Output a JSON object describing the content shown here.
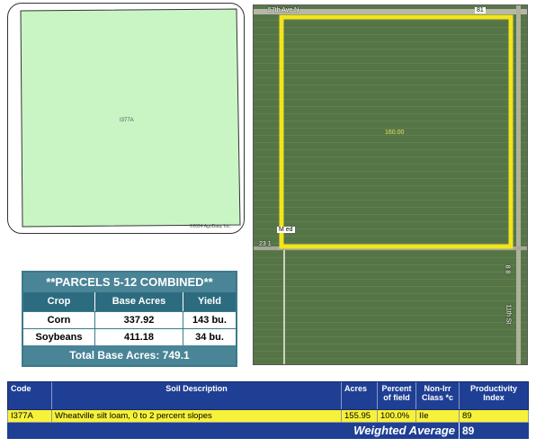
{
  "soil_map": {
    "map_label": "I377A",
    "credit": "©2024 AgriData, Inc."
  },
  "aerial": {
    "road_top": "57th Ave N",
    "road_shield": "81",
    "road_left": "23 1",
    "marker_label": "M ed",
    "road_right": "11th St",
    "road_right2": "8 8",
    "acres_label": "160.00",
    "colors": {
      "boundary": "#f3e41c",
      "field": "#567547"
    }
  },
  "parcels": {
    "title": "**PARCELS 5-12 COMBINED**",
    "headers": {
      "crop": "Crop",
      "base_acres": "Base Acres",
      "yield": "Yield"
    },
    "rows": [
      {
        "crop": "Corn",
        "base_acres": "337.92",
        "yield": "143 bu."
      },
      {
        "crop": "Soybeans",
        "base_acres": "411.18",
        "yield": "34 bu."
      }
    ],
    "total": "Total Base Acres: 749.1"
  },
  "soil_table": {
    "headers": {
      "code": "Code",
      "description": "Soil Description",
      "acres": "Acres",
      "percent": "Percent of field",
      "class": "Non-Irr Class *c",
      "pi": "Productivity Index"
    },
    "rows": [
      {
        "code": "I377A",
        "description": "Wheatville silt loam, 0 to 2 percent slopes",
        "acres": "155.95",
        "percent": "100.0%",
        "class": "IIe",
        "pi": "89"
      }
    ],
    "weighted_label": "Weighted Average",
    "weighted_value": "89"
  }
}
